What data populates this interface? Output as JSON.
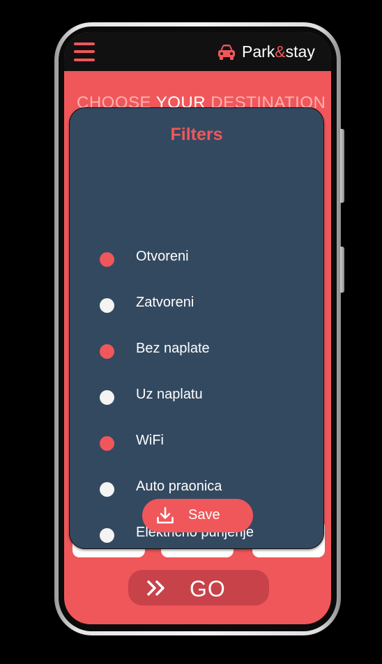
{
  "header": {
    "menu_icon": "hamburger-menu-icon",
    "car_icon": "car-icon",
    "brand_prefix": "Park",
    "brand_amp": "&",
    "brand_suffix": "stay",
    "accent_color": "#f0575a",
    "bar_color": "#111112"
  },
  "main": {
    "heading_part1": "CHOOSE ",
    "heading_part2": "YOUR",
    "heading_part3": " DESTINATION",
    "background_color": "#f0575a"
  },
  "filters_modal": {
    "title": "Filters",
    "background_color": "#334960",
    "options": [
      {
        "label": "Otvoreni",
        "selected": true
      },
      {
        "label": "Zatvoreni",
        "selected": false
      },
      {
        "label": "Bez naplate",
        "selected": true
      },
      {
        "label": "Uz naplatu",
        "selected": false
      },
      {
        "label": "WiFi",
        "selected": true
      },
      {
        "label": "Auto praonica",
        "selected": false
      },
      {
        "label": "Električno punjenje",
        "selected": false
      }
    ],
    "save_label": "Save",
    "save_icon": "download-icon"
  },
  "go_button": {
    "label": "GO",
    "icon": "double-chevron-right-icon"
  }
}
